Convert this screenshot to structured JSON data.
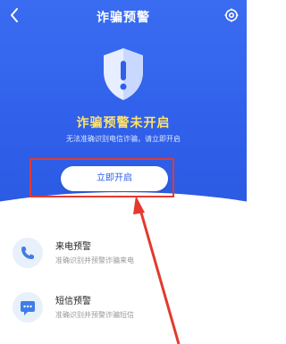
{
  "header": {
    "title": "诈骗预警",
    "back_icon": "back-arrow-icon",
    "settings_icon": "gear-icon"
  },
  "hero": {
    "status": "诈骗预警未开启",
    "description": "无法准确识别电信诈骗，请立即开启",
    "button_label": "立即开启",
    "shield_icon": "warning-shield-icon"
  },
  "features": [
    {
      "title": "来电预警",
      "description": "准确识别并预警诈骗来电",
      "icon": "phone-icon"
    },
    {
      "title": "短信预警",
      "description": "准确识别并预警诈骗短信",
      "icon": "message-icon"
    }
  ],
  "colors": {
    "primary": "#2f5fe9",
    "warning": "#ffe36a",
    "annotation": "#e23a2f"
  }
}
